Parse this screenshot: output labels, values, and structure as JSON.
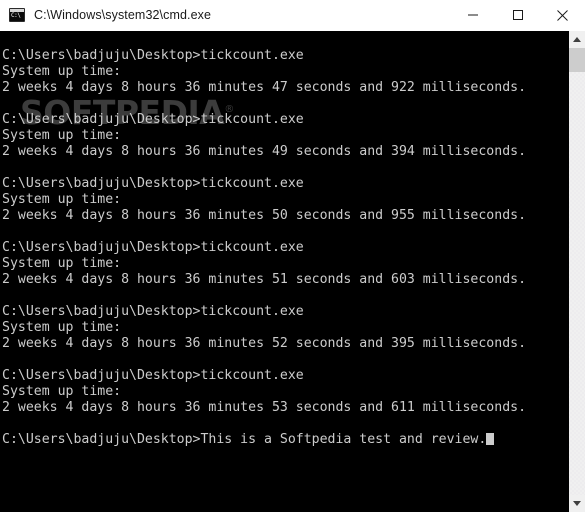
{
  "window": {
    "title": "C:\\Windows\\system32\\cmd.exe",
    "icon": "cmd-console-icon",
    "bg_color": "#000000",
    "titlebar_bg": "#ffffff",
    "text_color": "#cccccc"
  },
  "titlebar_controls": {
    "minimize_label": "Minimize",
    "maximize_label": "Maximize",
    "close_label": "Close"
  },
  "watermark": {
    "text": "SOFTPEDIA",
    "registered_mark": "®",
    "color": "#3c3c3c"
  },
  "console": {
    "prompt": "C:\\Users\\badjuju\\Desktop>",
    "cursor": "block-cursor",
    "lines": [
      {
        "text": "C:\\Users\\badjuju\\Desktop>tickcount.exe"
      },
      {
        "text": "System up time:"
      },
      {
        "text": "2 weeks 4 days 8 hours 36 minutes 47 seconds and 922 milliseconds."
      },
      {
        "text": ""
      },
      {
        "text": "C:\\Users\\badjuju\\Desktop>tickcount.exe"
      },
      {
        "text": "System up time:"
      },
      {
        "text": "2 weeks 4 days 8 hours 36 minutes 49 seconds and 394 milliseconds."
      },
      {
        "text": ""
      },
      {
        "text": "C:\\Users\\badjuju\\Desktop>tickcount.exe"
      },
      {
        "text": "System up time:"
      },
      {
        "text": "2 weeks 4 days 8 hours 36 minutes 50 seconds and 955 milliseconds."
      },
      {
        "text": ""
      },
      {
        "text": "C:\\Users\\badjuju\\Desktop>tickcount.exe"
      },
      {
        "text": "System up time:"
      },
      {
        "text": "2 weeks 4 days 8 hours 36 minutes 51 seconds and 603 milliseconds."
      },
      {
        "text": ""
      },
      {
        "text": "C:\\Users\\badjuju\\Desktop>tickcount.exe"
      },
      {
        "text": "System up time:"
      },
      {
        "text": "2 weeks 4 days 8 hours 36 minutes 52 seconds and 395 milliseconds."
      },
      {
        "text": ""
      },
      {
        "text": "C:\\Users\\badjuju\\Desktop>tickcount.exe"
      },
      {
        "text": "System up time:"
      },
      {
        "text": "2 weeks 4 days 8 hours 36 minutes 53 seconds and 611 milliseconds."
      },
      {
        "text": ""
      },
      {
        "text": "C:\\Users\\badjuju\\Desktop>This is a Softpedia test and review."
      }
    ]
  },
  "scrollbar": {
    "up_arrow": "chevron-up-icon",
    "down_arrow": "chevron-down-icon",
    "thumb": "scrollbar-thumb"
  }
}
